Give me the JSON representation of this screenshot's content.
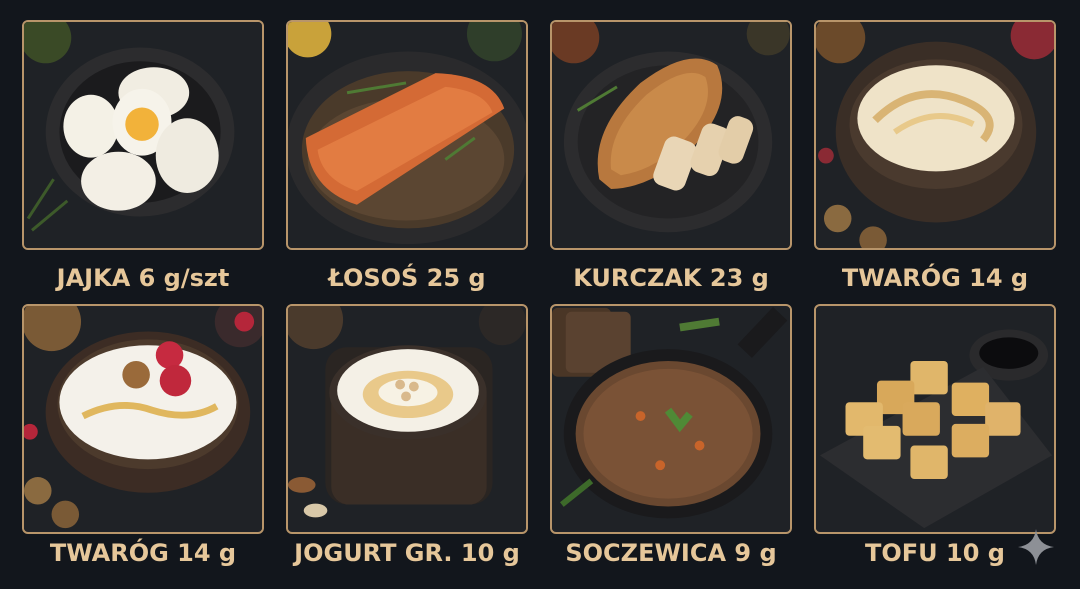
{
  "items": [
    {
      "label": "JAJKA 6 g/szt",
      "image": "boiled-eggs-bowl"
    },
    {
      "label": "ŁOSOŚ 25 g",
      "image": "salmon-fillet-plate"
    },
    {
      "label": "KURCZAK 23 g",
      "image": "grilled-chicken-plate"
    },
    {
      "label": "TWARÓG 14 g",
      "image": "cottage-cheese-bowl"
    },
    {
      "label": "TWARÓG 14 g",
      "image": "cottage-cheese-raspberries-bowl"
    },
    {
      "label": "JOGURT GR. 10 g",
      "image": "greek-yogurt-jar"
    },
    {
      "label": "SOCZEWICA 9 g",
      "image": "lentils-skillet"
    },
    {
      "label": "TOFU 10 g",
      "image": "tofu-cubes-board"
    }
  ],
  "colors": {
    "background": "#12161c",
    "tile_border": "#b8956a",
    "label": "#e6c79a"
  },
  "icons": {
    "corner": "sparkle-icon"
  }
}
